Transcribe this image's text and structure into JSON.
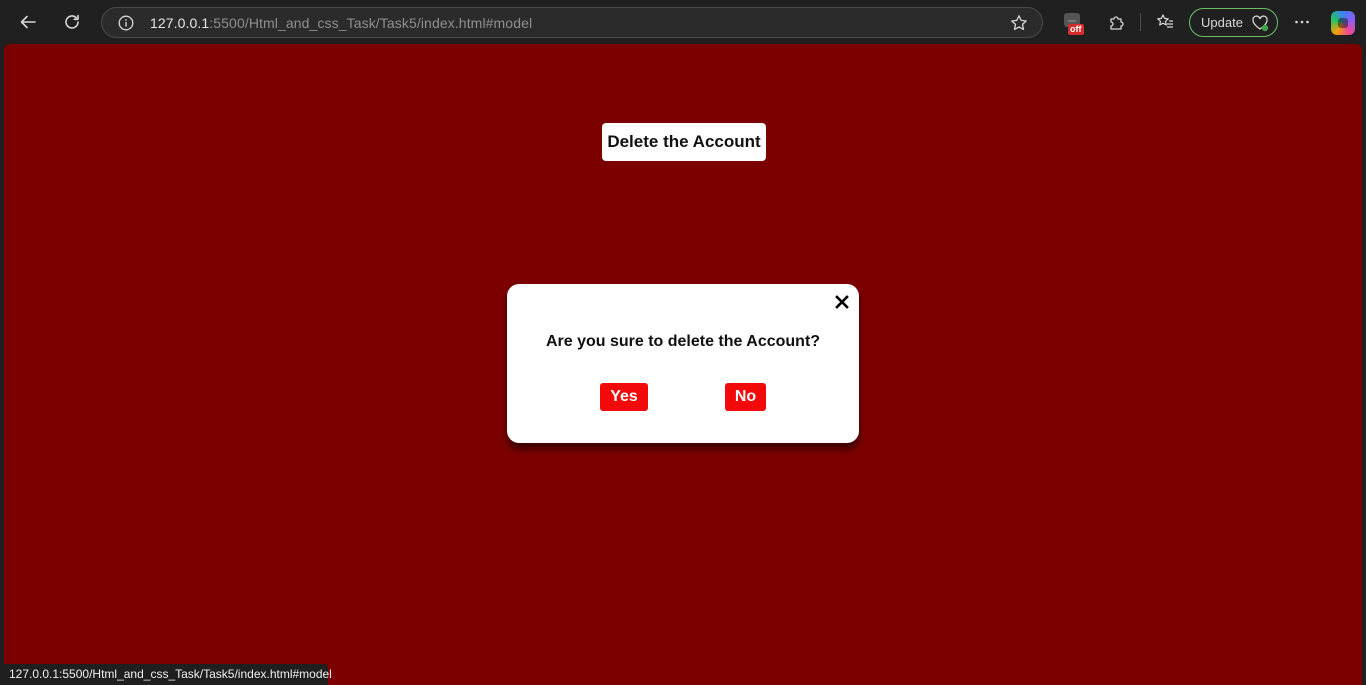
{
  "browser": {
    "url_host": "127.0.0.1",
    "url_rest": ":5500/Html_and_css_Task/Task5/index.html#model",
    "update_label": "Update",
    "extension_badge": "off",
    "status_url": "127.0.0.1:5500/Html_and_css_Task/Task5/index.html#model",
    "icons": [
      "back-icon",
      "refresh-icon",
      "info-icon",
      "star-icon",
      "extension-badge-icon",
      "puzzle-icon",
      "favorites-icon",
      "heart-icon",
      "more-icon",
      "copilot-icon"
    ]
  },
  "page": {
    "delete_button_label": "Delete the Account",
    "background_color": "#7d0000"
  },
  "modal": {
    "question": "Are you sure to delete the Account?",
    "yes_label": "Yes",
    "no_label": "No",
    "close_glyph": "×",
    "button_color": "#f20a0a"
  }
}
